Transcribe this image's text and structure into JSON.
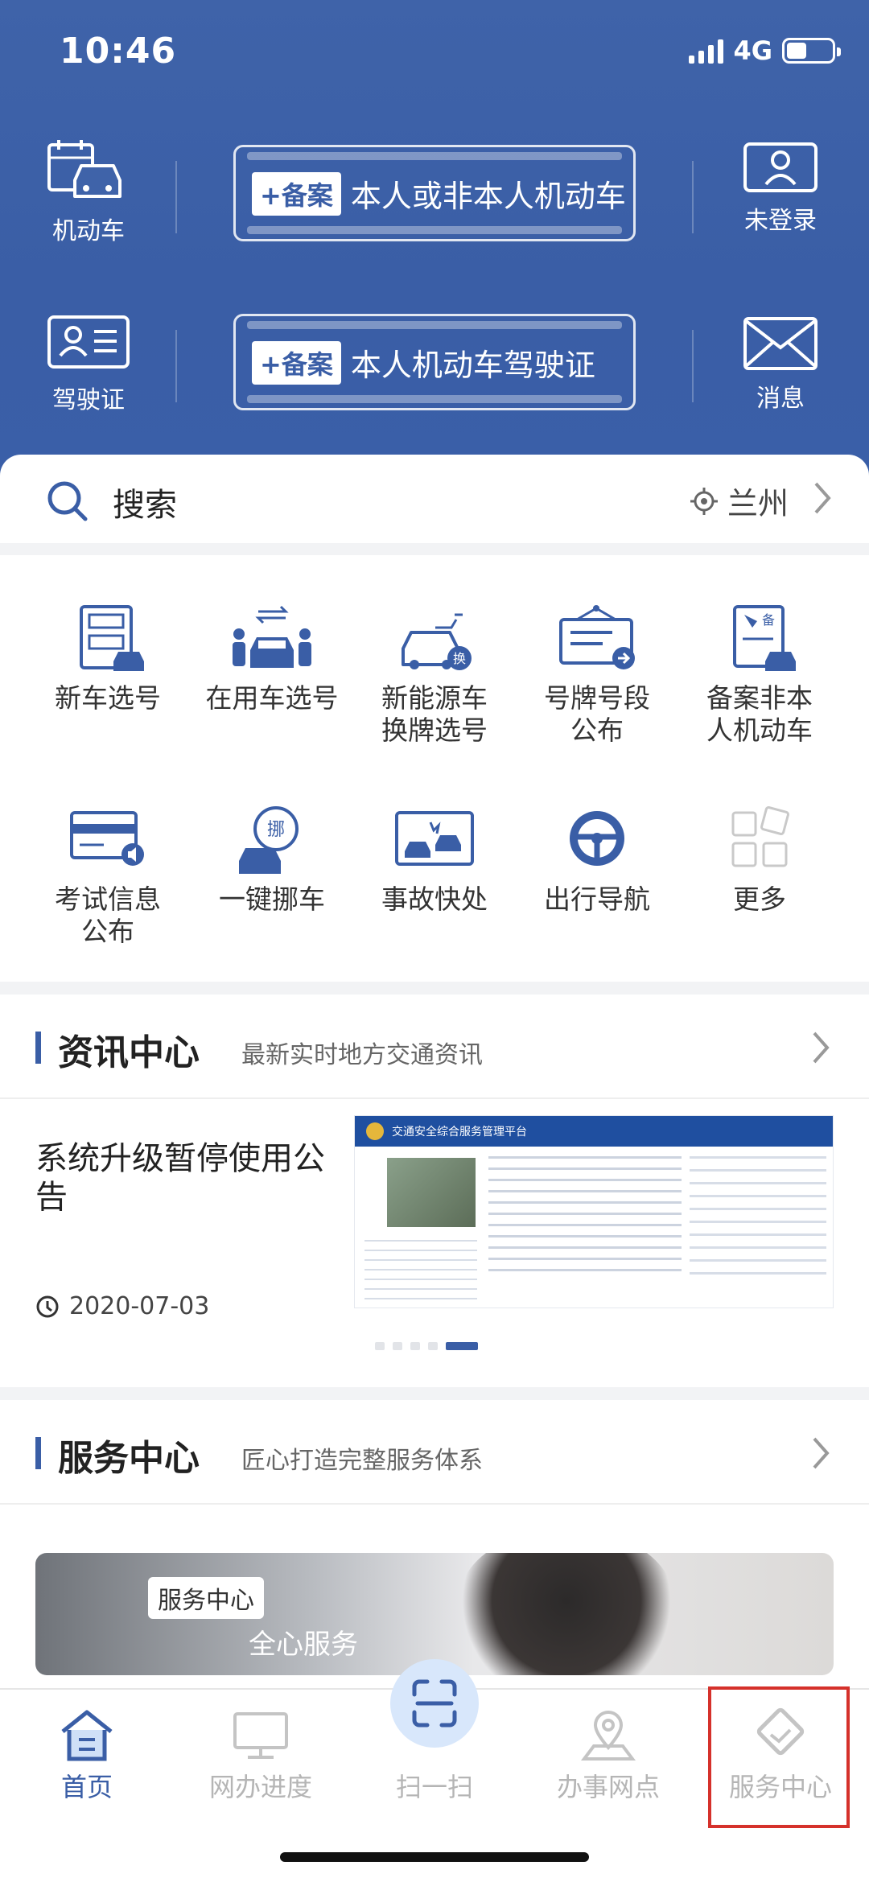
{
  "status_bar": {
    "time": "10:46",
    "network": "4G"
  },
  "header": {
    "left_top": {
      "label": "机动车",
      "icon": "car-calendar-icon"
    },
    "left_bottom": {
      "label": "驾驶证",
      "icon": "license-card-icon"
    },
    "right_top": {
      "label": "未登录",
      "icon": "user-icon"
    },
    "right_bottom": {
      "label": "消息",
      "icon": "mail-icon"
    },
    "ticket1": {
      "badge": "+备案",
      "text": "本人或非本人机动车"
    },
    "ticket2": {
      "badge": "+备案",
      "text": "本人机动车驾驶证"
    }
  },
  "search": {
    "placeholder": "搜索",
    "location": "兰州"
  },
  "services": [
    {
      "label": "新车选号",
      "icon": "new-plate-icon"
    },
    {
      "label": "在用车选号",
      "icon": "swap-car-icon"
    },
    {
      "label": "新能源车\n换牌选号",
      "icon": "ev-car-icon"
    },
    {
      "label": "号牌号段\n公布",
      "icon": "plate-notice-icon"
    },
    {
      "label": "备案非本\n人机动车",
      "icon": "record-car-icon"
    },
    {
      "label": "考试信息\n公布",
      "icon": "exam-info-icon"
    },
    {
      "label": "一键挪车",
      "icon": "move-car-icon"
    },
    {
      "label": "事故快处",
      "icon": "accident-icon"
    },
    {
      "label": "出行导航",
      "icon": "steering-wheel-icon"
    },
    {
      "label": "更多",
      "icon": "more-grid-icon"
    }
  ],
  "news_section": {
    "title": "资讯中心",
    "subtitle": "最新实时地方交通资讯",
    "article_title": "系统升级暂停使用公告",
    "date": "2020-07-03",
    "thumb_site_title": "交通安全综合服务管理平台"
  },
  "service_section": {
    "title": "服务中心",
    "subtitle": "匠心打造完整服务体系",
    "banner_tag": "服务中心",
    "banner_text": "全心服务"
  },
  "tabbar": {
    "home": "首页",
    "progress": "网办进度",
    "scan": "扫一扫",
    "outlets": "办事网点",
    "service": "服务中心"
  },
  "colors": {
    "brand": "#3a5ea6",
    "highlight": "#d5312b",
    "inactive": "#b5b5b5"
  }
}
